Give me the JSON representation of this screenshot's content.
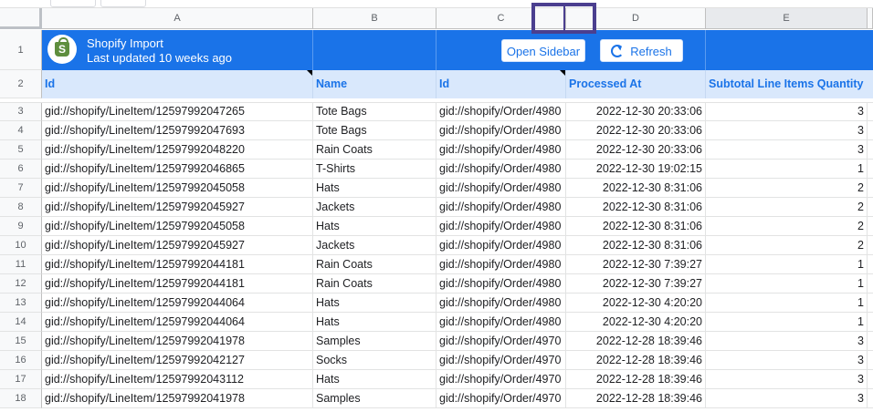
{
  "columns": [
    "A",
    "B",
    "C",
    "D",
    "E"
  ],
  "banner": {
    "title": "Shopify Import",
    "subtitle": "Last updated 10 weeks ago",
    "open_sidebar": "Open Sidebar",
    "refresh": "Refresh"
  },
  "headers": [
    "Id",
    "Name",
    "Id",
    "Processed At",
    "Subtotal Line Items Quantity"
  ],
  "rows": [
    {
      "n": "3",
      "a": "gid://shopify/LineItem/12597992047265",
      "b": "Tote Bags",
      "c": "gid://shopify/Order/4980",
      "d": "2022-12-30 20:33:06",
      "e": "3"
    },
    {
      "n": "4",
      "a": "gid://shopify/LineItem/12597992047693",
      "b": "Tote Bags",
      "c": "gid://shopify/Order/4980",
      "d": "2022-12-30 20:33:06",
      "e": "3"
    },
    {
      "n": "5",
      "a": "gid://shopify/LineItem/12597992048220",
      "b": "Rain Coats",
      "c": "gid://shopify/Order/4980",
      "d": "2022-12-30 20:33:06",
      "e": "3"
    },
    {
      "n": "6",
      "a": "gid://shopify/LineItem/12597992046865",
      "b": "T-Shirts",
      "c": "gid://shopify/Order/4980",
      "d": "2022-12-30 19:02:15",
      "e": "1"
    },
    {
      "n": "7",
      "a": "gid://shopify/LineItem/12597992045058",
      "b": "Hats",
      "c": "gid://shopify/Order/4980",
      "d": "2022-12-30 8:31:06",
      "e": "2"
    },
    {
      "n": "8",
      "a": "gid://shopify/LineItem/12597992045927",
      "b": "Jackets",
      "c": "gid://shopify/Order/4980",
      "d": "2022-12-30 8:31:06",
      "e": "2"
    },
    {
      "n": "9",
      "a": "gid://shopify/LineItem/12597992045058",
      "b": "Hats",
      "c": "gid://shopify/Order/4980",
      "d": "2022-12-30 8:31:06",
      "e": "2"
    },
    {
      "n": "10",
      "a": "gid://shopify/LineItem/12597992045927",
      "b": "Jackets",
      "c": "gid://shopify/Order/4980",
      "d": "2022-12-30 8:31:06",
      "e": "2"
    },
    {
      "n": "11",
      "a": "gid://shopify/LineItem/12597992044181",
      "b": "Rain Coats",
      "c": "gid://shopify/Order/4980",
      "d": "2022-12-30 7:39:27",
      "e": "1"
    },
    {
      "n": "12",
      "a": "gid://shopify/LineItem/12597992044181",
      "b": "Rain Coats",
      "c": "gid://shopify/Order/4980",
      "d": "2022-12-30 7:39:27",
      "e": "1"
    },
    {
      "n": "13",
      "a": "gid://shopify/LineItem/12597992044064",
      "b": "Hats",
      "c": "gid://shopify/Order/4980",
      "d": "2022-12-30 4:20:20",
      "e": "1"
    },
    {
      "n": "14",
      "a": "gid://shopify/LineItem/12597992044064",
      "b": "Hats",
      "c": "gid://shopify/Order/4980",
      "d": "2022-12-30 4:20:20",
      "e": "1"
    },
    {
      "n": "15",
      "a": "gid://shopify/LineItem/12597992041978",
      "b": "Samples",
      "c": "gid://shopify/Order/4970",
      "d": "2022-12-28 18:39:46",
      "e": "3"
    },
    {
      "n": "16",
      "a": "gid://shopify/LineItem/12597992042127",
      "b": "Socks",
      "c": "gid://shopify/Order/4970",
      "d": "2022-12-28 18:39:46",
      "e": "3"
    },
    {
      "n": "17",
      "a": "gid://shopify/LineItem/12597992043112",
      "b": "Hats",
      "c": "gid://shopify/Order/4970",
      "d": "2022-12-28 18:39:46",
      "e": "3"
    },
    {
      "n": "18",
      "a": "gid://shopify/LineItem/12597992041978",
      "b": "Samples",
      "c": "gid://shopify/Order/4970",
      "d": "2022-12-28 18:39:46",
      "e": "3"
    }
  ]
}
